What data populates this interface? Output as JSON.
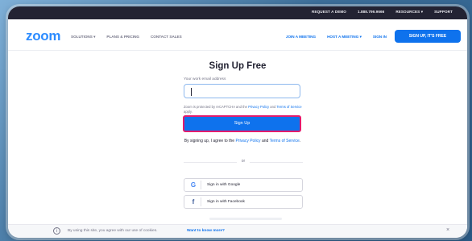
{
  "topbar": {
    "items": [
      "REQUEST A DEMO",
      "1.888.799.9666",
      "RESOURCES ▾",
      "SUPPORT"
    ]
  },
  "nav": {
    "logo": "zoom",
    "left_items": [
      "SOLUTIONS ▾",
      "PLANS & PRICING",
      "CONTACT SALES"
    ],
    "right_items": [
      "JOIN A MEETING",
      "HOST A MEETING ▾",
      "SIGN IN"
    ],
    "cta": "SIGN UP, IT'S FREE"
  },
  "form": {
    "title": "Sign Up Free",
    "email_label": "Your work email address",
    "email_value": "",
    "recaptcha_prefix": "Zoom is protected by reCAPTCHA and the ",
    "recaptcha_privacy": "Privacy Policy",
    "recaptcha_and": " and ",
    "recaptcha_terms": "Terms of Service",
    "recaptcha_suffix": " apply.",
    "signup_button": "Sign Up",
    "agree_prefix": "By signing up, I agree to the ",
    "agree_privacy": "Privacy Policy",
    "agree_and": " and ",
    "agree_terms": "Terms of Service",
    "agree_suffix": ".",
    "or_label": "or",
    "google_label": "Sign in with Google",
    "facebook_label": "Sign in with Facebook"
  },
  "cookie_bar": {
    "text": "By using this site, you agree with our use of cookies.",
    "link": "Want to know more?",
    "close": "×"
  },
  "colors": {
    "brand_blue": "#2d8cff",
    "button_blue": "#0e72ed",
    "highlight_border": "#e31b6d"
  }
}
